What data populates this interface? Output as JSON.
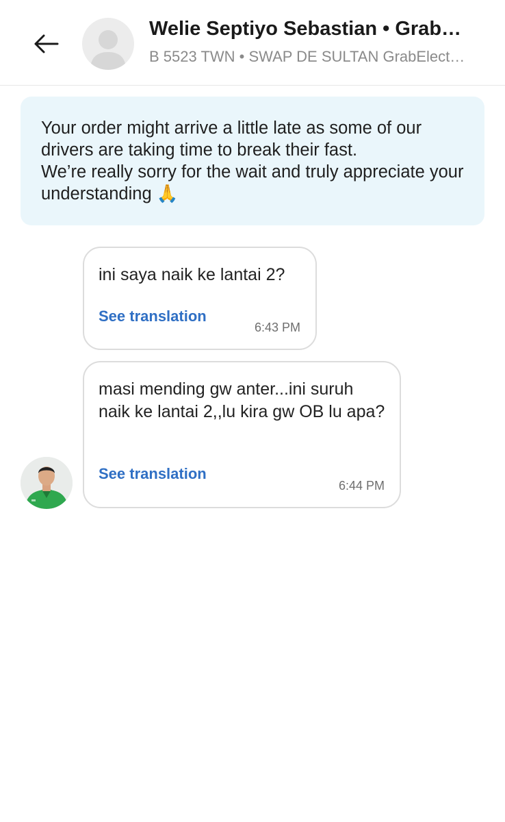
{
  "header": {
    "title": "Welie Septiyo Sebastian • Grab…",
    "subtitle": "B 5523 TWN • SWAP DE SULTAN GrabElect…",
    "back_icon": "arrow-left-icon",
    "avatar_icon": "person-placeholder-icon"
  },
  "notice": {
    "line1": "Your order might arrive a little late as some of our drivers are taking time to break their fast.",
    "line2": "We’re really sorry for the wait and truly appreciate your understanding 🙏"
  },
  "messages": [
    {
      "text": "ini saya naik ke lantai 2?",
      "translate_label": "See translation",
      "time": "6:43 PM"
    },
    {
      "text": "masi mending gw anter...ini suruh naik ke lantai 2,,lu kira gw OB lu apa?",
      "translate_label": "See translation",
      "time": "6:44 PM",
      "sender_avatar": "driver-photo"
    }
  ],
  "colors": {
    "notice_bg": "#eaf6fb",
    "link": "#2f6fc4",
    "driver_jacket": "#2fa84f"
  }
}
